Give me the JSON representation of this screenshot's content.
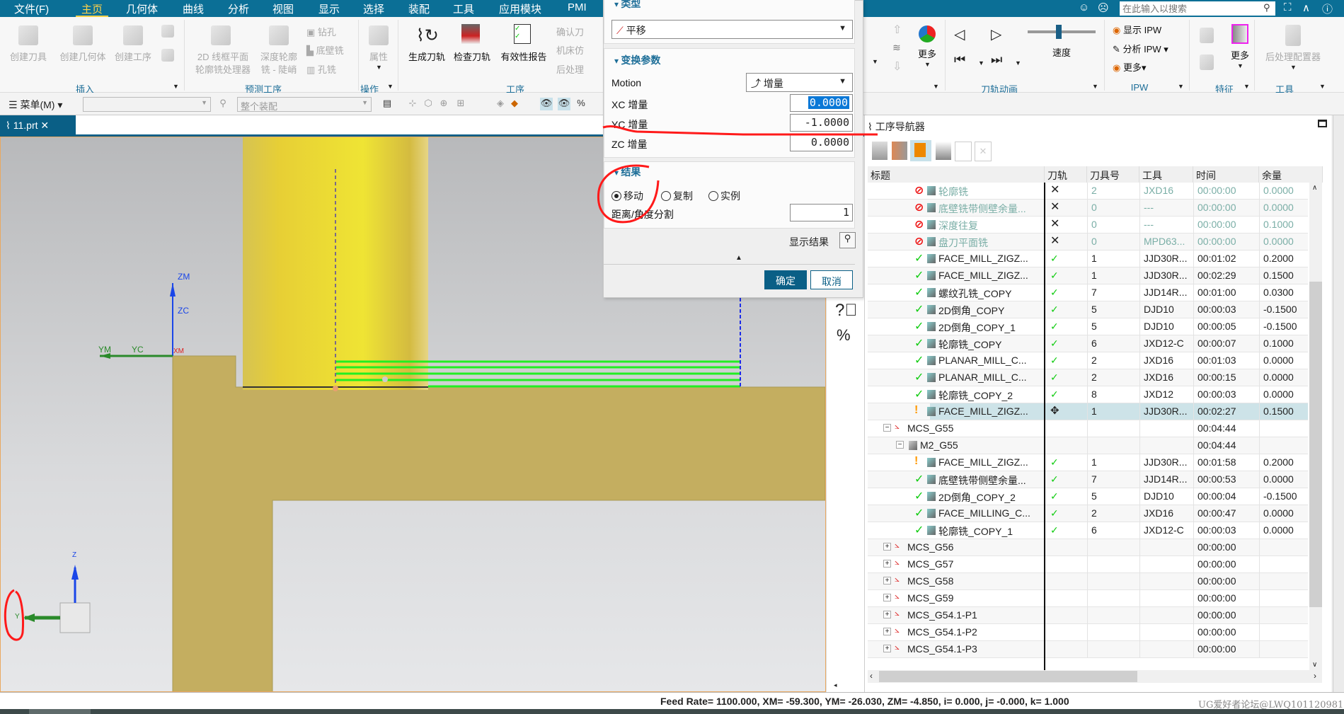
{
  "menubar": {
    "items": [
      "文件(F)",
      "主页",
      "几何体",
      "曲线",
      "分析",
      "视图",
      "显示",
      "选择",
      "装配",
      "工具",
      "应用模块",
      "PMI"
    ],
    "active": "主页",
    "search_placeholder": "在此输入以搜索"
  },
  "ribbon": {
    "insert": {
      "create_tool": "创建刀具",
      "create_geometry": "创建几何体",
      "create_operation": "创建工序",
      "group": "插入"
    },
    "predict": {
      "wireframe_1": "2D 线框平面",
      "wireframe_2": "轮廓铣处理器",
      "depth_1": "深度轮廓",
      "depth_2": "铣 - 陡峭",
      "drill": "钻孔",
      "floor_wall": "底壁铣",
      "hole_mill": "孔铣",
      "group": "预测工序"
    },
    "ops": {
      "properties": "属性",
      "group": "操作"
    },
    "process": {
      "generate": "生成刀轨",
      "verify": "检查刀轨",
      "report": "有效性报告",
      "confirm": "确认刀",
      "machine_sim": "机床仿",
      "postprocess": "后处理",
      "group": "工序"
    },
    "more": "更多",
    "animation": {
      "speed": "速度",
      "group": "刀轨动画",
      "speed_level": 0.45
    },
    "ipw": {
      "show": "显示 IPW",
      "analyze": "分析 IPW",
      "more": "更多",
      "group": "IPW"
    },
    "feature": {
      "more": "更多",
      "group": "特征"
    },
    "tools": {
      "post_config": "后处理配置器",
      "group": "工具"
    }
  },
  "toolbar": {
    "menu": "菜单(M)",
    "filter_combo": "",
    "assembly_combo": "整个装配"
  },
  "doc_tab": {
    "name": "11.prt"
  },
  "dialog": {
    "type_header": "类型",
    "type_value": "平移",
    "params_header": "变换参数",
    "motion_label": "Motion",
    "motion_value": "增量",
    "xc_label": "XC 增量",
    "xc_value": "0.0000",
    "yc_label": "YC 增量",
    "yc_value": "-1.0000",
    "zc_label": "ZC 增量",
    "zc_value": "0.0000",
    "result_header": "结果",
    "radio_move": "移动",
    "radio_copy": "复制",
    "radio_instance": "实例",
    "selected_radio": "移动",
    "divide_label": "距离/角度分割",
    "divide_value": "1",
    "show_result": "显示结果",
    "ok": "确定",
    "cancel": "取消"
  },
  "viewport": {
    "wcs_labels": {
      "zm": "ZM",
      "zc": "ZC",
      "ym": "YM",
      "yc": "YC",
      "xm": "XM"
    },
    "triad": {
      "z": "Z",
      "y": "Y"
    }
  },
  "navigator": {
    "title": "工序导航器",
    "columns": [
      "标题",
      "刀轨",
      "刀具号",
      "工具",
      "时间",
      "余量"
    ],
    "rows": [
      {
        "title": "轮廓铣",
        "status": "disabled",
        "kind": "op",
        "path": "x",
        "tool_no": "2",
        "tool": "JXD16",
        "time": "00:00:00",
        "stock": "0.0000"
      },
      {
        "title": "底壁铣带侧壁余量...",
        "status": "disabled",
        "kind": "op",
        "path": "x",
        "tool_no": "0",
        "tool": "---",
        "time": "00:00:00",
        "stock": "0.0000"
      },
      {
        "title": "深度往复",
        "status": "disabled",
        "kind": "op",
        "path": "x",
        "tool_no": "0",
        "tool": "---",
        "time": "00:00:00",
        "stock": "0.1000"
      },
      {
        "title": "盘刀平面铣",
        "status": "disabled",
        "kind": "op",
        "path": "x",
        "tool_no": "0",
        "tool": "MPD63...",
        "time": "00:00:00",
        "stock": "0.0000"
      },
      {
        "title": "FACE_MILL_ZIGZ...",
        "status": "ok",
        "kind": "op",
        "path": "ok",
        "tool_no": "1",
        "tool": "JJD30R...",
        "time": "00:01:02",
        "stock": "0.2000"
      },
      {
        "title": "FACE_MILL_ZIGZ...",
        "status": "ok",
        "kind": "op",
        "path": "ok",
        "tool_no": "1",
        "tool": "JJD30R...",
        "time": "00:02:29",
        "stock": "0.1500"
      },
      {
        "title": "螺纹孔铣_COPY",
        "status": "ok",
        "kind": "op",
        "path": "ok",
        "tool_no": "7",
        "tool": "JJD14R...",
        "time": "00:01:00",
        "stock": "0.0300"
      },
      {
        "title": "2D倒角_COPY",
        "status": "ok",
        "kind": "op",
        "path": "ok",
        "tool_no": "5",
        "tool": "DJD10",
        "time": "00:00:03",
        "stock": "-0.1500"
      },
      {
        "title": "2D倒角_COPY_1",
        "status": "ok",
        "kind": "op",
        "path": "ok",
        "tool_no": "5",
        "tool": "DJD10",
        "time": "00:00:05",
        "stock": "-0.1500"
      },
      {
        "title": "轮廓铣_COPY",
        "status": "ok",
        "kind": "op",
        "path": "ok",
        "tool_no": "6",
        "tool": "JXD12-C",
        "time": "00:00:07",
        "stock": "0.1000"
      },
      {
        "title": "PLANAR_MILL_C...",
        "status": "ok",
        "kind": "op",
        "path": "ok",
        "tool_no": "2",
        "tool": "JXD16",
        "time": "00:01:03",
        "stock": "0.0000"
      },
      {
        "title": "PLANAR_MILL_C...",
        "status": "ok",
        "kind": "op",
        "path": "ok",
        "tool_no": "2",
        "tool": "JXD16",
        "time": "00:00:15",
        "stock": "0.0000"
      },
      {
        "title": "轮廓铣_COPY_2",
        "status": "ok",
        "kind": "op",
        "path": "ok",
        "tool_no": "8",
        "tool": "JXD12",
        "time": "00:00:03",
        "stock": "0.0000"
      },
      {
        "title": "FACE_MILL_ZIGZ...",
        "status": "warn",
        "kind": "op",
        "path": "move",
        "tool_no": "1",
        "tool": "JJD30R...",
        "time": "00:02:27",
        "stock": "0.1500",
        "selected": true
      },
      {
        "title": "MCS_G55",
        "status": "",
        "kind": "mcs",
        "expander": "−",
        "path": "",
        "tool_no": "",
        "tool": "",
        "time": "00:04:44",
        "stock": ""
      },
      {
        "title": "M2_G55",
        "status": "",
        "kind": "geom",
        "expander": "−",
        "path": "",
        "tool_no": "",
        "tool": "",
        "time": "00:04:44",
        "stock": ""
      },
      {
        "title": "FACE_MILL_ZIGZ...",
        "status": "warn",
        "kind": "op",
        "path": "ok",
        "tool_no": "1",
        "tool": "JJD30R...",
        "time": "00:01:58",
        "stock": "0.2000"
      },
      {
        "title": "底壁铣带侧壁余量...",
        "status": "ok",
        "kind": "op",
        "path": "ok",
        "tool_no": "7",
        "tool": "JJD14R...",
        "time": "00:00:53",
        "stock": "0.0000"
      },
      {
        "title": "2D倒角_COPY_2",
        "status": "ok",
        "kind": "op",
        "path": "ok",
        "tool_no": "5",
        "tool": "DJD10",
        "time": "00:00:04",
        "stock": "-0.1500"
      },
      {
        "title": "FACE_MILLING_C...",
        "status": "ok",
        "kind": "op",
        "path": "ok",
        "tool_no": "2",
        "tool": "JXD16",
        "time": "00:00:47",
        "stock": "0.0000"
      },
      {
        "title": "轮廓铣_COPY_1",
        "status": "ok",
        "kind": "op",
        "path": "ok",
        "tool_no": "6",
        "tool": "JXD12-C",
        "time": "00:00:03",
        "stock": "0.0000"
      },
      {
        "title": "MCS_G56",
        "status": "",
        "kind": "mcs",
        "expander": "+",
        "path": "",
        "tool_no": "",
        "tool": "",
        "time": "00:00:00",
        "stock": ""
      },
      {
        "title": "MCS_G57",
        "status": "",
        "kind": "mcs",
        "expander": "+",
        "path": "",
        "tool_no": "",
        "tool": "",
        "time": "00:00:00",
        "stock": ""
      },
      {
        "title": "MCS_G58",
        "status": "",
        "kind": "mcs",
        "expander": "+",
        "path": "",
        "tool_no": "",
        "tool": "",
        "time": "00:00:00",
        "stock": ""
      },
      {
        "title": "MCS_G59",
        "status": "",
        "kind": "mcs",
        "expander": "+",
        "path": "",
        "tool_no": "",
        "tool": "",
        "time": "00:00:00",
        "stock": ""
      },
      {
        "title": "MCS_G54.1-P1",
        "status": "",
        "kind": "mcs",
        "expander": "+",
        "path": "",
        "tool_no": "",
        "tool": "",
        "time": "00:00:00",
        "stock": ""
      },
      {
        "title": "MCS_G54.1-P2",
        "status": "",
        "kind": "mcs",
        "expander": "+",
        "path": "",
        "tool_no": "",
        "tool": "",
        "time": "00:00:00",
        "stock": ""
      },
      {
        "title": "MCS_G54.1-P3",
        "status": "",
        "kind": "mcs",
        "expander": "+",
        "path": "",
        "tool_no": "",
        "tool": "",
        "time": "00:00:00",
        "stock": ""
      }
    ]
  },
  "statusbar": {
    "text": "Feed Rate= 1100.000, XM= -59.300, YM= -26.030, ZM= -4.850, i= 0.000, j= -0.000, k= 1.000",
    "watermark": "UG爱好者论坛@LWQ101120981"
  },
  "colors": {
    "menubar": "#0b6f96",
    "accent": "#0a5f86",
    "part": "#c4ae60",
    "tool": "#e8d43a",
    "toolpath": "#22ee22",
    "selected_row": "#cde3e8",
    "annotation": "#ff1a1a"
  }
}
